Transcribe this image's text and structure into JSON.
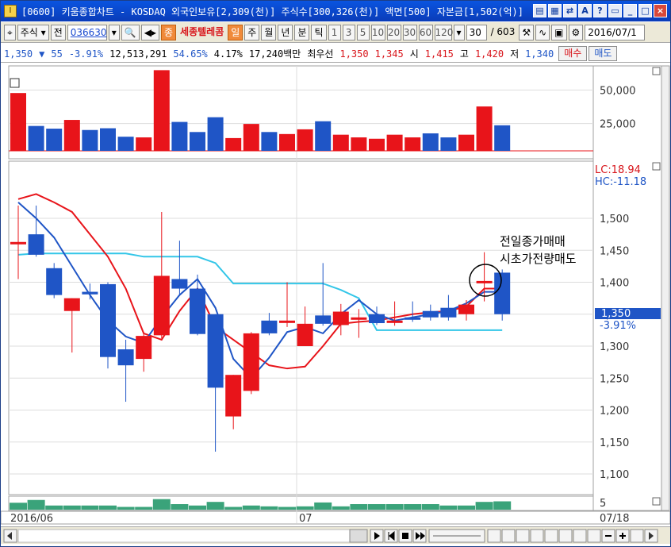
{
  "title": "[0600] 키움종합차트 - KOSDAQ 외국인보유[2,309(천)] 주식수[300,326(천)] 액면[500] 자본금[1,502(억)]",
  "toolbar": {
    "market": "주식",
    "field": "전",
    "code": "036630",
    "badge": "종",
    "stock_name": "세종텔레콤",
    "period_day": "일",
    "period_week": "주",
    "period_month": "월",
    "period_year": "년",
    "period_min": "분",
    "period_tick": "틱",
    "intervals": [
      "1",
      "3",
      "5",
      "10",
      "20",
      "30",
      "60",
      "120"
    ],
    "count": "30",
    "total": "/ 603",
    "date": "2016/07/1"
  },
  "pricebar": {
    "price": "1,350",
    "arrow": "▼",
    "change": "55",
    "change_pct": "-3.91%",
    "volume": "12,513,291",
    "ratio1": "54.65%",
    "ratio2": "4.17%",
    "amount": "17,240백만",
    "best_label": "최우선",
    "best_ask": "1,350",
    "best_bid": "1,345",
    "open_label": "시",
    "open": "1,415",
    "high_label": "고",
    "high": "1,420",
    "low_label": "저",
    "low": "1,340",
    "buy_label": "매수",
    "sell_label": "매도"
  },
  "chart_data": {
    "type": "candlestick",
    "x_start_label": "2016/06",
    "x_mid_label": "07",
    "x_end_label": "07/18",
    "price_axis": {
      "ticks": [
        "1,500",
        "1,450",
        "1,400",
        "1,350",
        "1,300",
        "1,250",
        "1,200",
        "1,150",
        "1,100"
      ],
      "range": [
        1060,
        1560
      ]
    },
    "volume_axis": {
      "ticks": [
        "50,000",
        "25,000"
      ],
      "range": [
        0,
        62000
      ]
    },
    "lc_label": "LC:18.94",
    "hc_label": "HC:-11.18",
    "current_price_label": "1,350",
    "current_change_label": "-3.91%",
    "annotation_line1": "전일종가매매",
    "annotation_line2": "시초가전량매도",
    "sub_axis_label": "5",
    "candles": [
      {
        "o": 1463,
        "c": 1463,
        "h": 1520,
        "l": 1405,
        "up": true
      },
      {
        "o": 1475,
        "c": 1443,
        "h": 1520,
        "l": 1440,
        "up": false
      },
      {
        "o": 1422,
        "c": 1380,
        "h": 1430,
        "l": 1375,
        "up": false
      },
      {
        "o": 1355,
        "c": 1375,
        "h": 1375,
        "l": 1290,
        "up": true
      },
      {
        "o": 1385,
        "c": 1381,
        "h": 1398,
        "l": 1373,
        "up": false
      },
      {
        "o": 1397,
        "c": 1283,
        "h": 1400,
        "l": 1265,
        "up": false
      },
      {
        "o": 1295,
        "c": 1270,
        "h": 1310,
        "l": 1213,
        "up": false
      },
      {
        "o": 1280,
        "c": 1316,
        "h": 1320,
        "l": 1260,
        "up": true
      },
      {
        "o": 1317,
        "c": 1410,
        "h": 1510,
        "l": 1312,
        "up": true
      },
      {
        "o": 1405,
        "c": 1390,
        "h": 1465,
        "l": 1380,
        "up": false
      },
      {
        "o": 1390,
        "c": 1319,
        "h": 1412,
        "l": 1317,
        "up": false
      },
      {
        "o": 1350,
        "c": 1235,
        "h": 1350,
        "l": 1135,
        "up": false
      },
      {
        "o": 1190,
        "c": 1255,
        "h": 1255,
        "l": 1170,
        "up": true
      },
      {
        "o": 1230,
        "c": 1320,
        "h": 1322,
        "l": 1225,
        "up": true
      },
      {
        "o": 1340,
        "c": 1320,
        "h": 1352,
        "l": 1317,
        "up": false
      },
      {
        "o": 1339,
        "c": 1340,
        "h": 1400,
        "l": 1330,
        "up": true
      },
      {
        "o": 1300,
        "c": 1335,
        "h": 1362,
        "l": 1300,
        "up": true
      },
      {
        "o": 1348,
        "c": 1335,
        "h": 1430,
        "l": 1332,
        "up": false
      },
      {
        "o": 1333,
        "c": 1354,
        "h": 1366,
        "l": 1317,
        "up": true
      },
      {
        "o": 1345,
        "c": 1345,
        "h": 1358,
        "l": 1313,
        "up": true
      },
      {
        "o": 1350,
        "c": 1336,
        "h": 1362,
        "l": 1333,
        "up": false
      },
      {
        "o": 1340,
        "c": 1340,
        "h": 1370,
        "l": 1332,
        "up": true
      },
      {
        "o": 1345,
        "c": 1345,
        "h": 1370,
        "l": 1338,
        "up": false
      },
      {
        "o": 1345,
        "c": 1355,
        "h": 1365,
        "l": 1340,
        "up": false
      },
      {
        "o": 1345,
        "c": 1360,
        "h": 1380,
        "l": 1340,
        "up": false
      },
      {
        "o": 1350,
        "c": 1365,
        "h": 1372,
        "l": 1340,
        "up": true
      },
      {
        "o": 1402,
        "c": 1402,
        "h": 1447,
        "l": 1370,
        "up": true
      },
      {
        "o": 1415,
        "c": 1350,
        "h": 1420,
        "l": 1340,
        "up": false
      }
    ],
    "volumes": [
      {
        "v": 43000,
        "up": true
      },
      {
        "v": 18500,
        "up": false
      },
      {
        "v": 16500,
        "up": false
      },
      {
        "v": 23000,
        "up": true
      },
      {
        "v": 15500,
        "up": false
      },
      {
        "v": 16800,
        "up": false
      },
      {
        "v": 10500,
        "up": false
      },
      {
        "v": 10000,
        "up": true
      },
      {
        "v": 60000,
        "up": true
      },
      {
        "v": 21500,
        "up": false
      },
      {
        "v": 14000,
        "up": false
      },
      {
        "v": 25000,
        "up": false
      },
      {
        "v": 9500,
        "up": true
      },
      {
        "v": 20000,
        "up": true
      },
      {
        "v": 14000,
        "up": false
      },
      {
        "v": 12500,
        "up": true
      },
      {
        "v": 16000,
        "up": true
      },
      {
        "v": 22000,
        "up": false
      },
      {
        "v": 12000,
        "up": true
      },
      {
        "v": 10000,
        "up": true
      },
      {
        "v": 9000,
        "up": true
      },
      {
        "v": 12000,
        "up": true
      },
      {
        "v": 10000,
        "up": true
      },
      {
        "v": 13000,
        "up": false
      },
      {
        "v": 10000,
        "up": false
      },
      {
        "v": 12000,
        "up": true
      },
      {
        "v": 33000,
        "up": true
      },
      {
        "v": 19000,
        "up": false
      }
    ],
    "line_red": [
      1530,
      1538,
      1525,
      1510,
      1475,
      1440,
      1390,
      1320,
      1310,
      1355,
      1390,
      1330,
      1310,
      1290,
      1270,
      1265,
      1268,
      1300,
      1335,
      1338,
      1340,
      1345,
      1350,
      1353,
      1355,
      1362,
      1390,
      1390
    ],
    "line_blue": [
      1525,
      1500,
      1470,
      1425,
      1380,
      1340,
      1315,
      1305,
      1345,
      1380,
      1405,
      1360,
      1280,
      1250,
      1282,
      1322,
      1330,
      1320,
      1350,
      1372,
      1350,
      1340,
      1345,
      1350,
      1355,
      1367,
      1385,
      1385
    ],
    "line_cyan": [
      1443,
      1445,
      1445,
      1445,
      1445,
      1445,
      1445,
      1440,
      1440,
      1440,
      1440,
      1430,
      1398,
      1398,
      1398,
      1398,
      1398,
      1398,
      1388,
      1375,
      1325,
      1325,
      1325,
      1325,
      1325,
      1325,
      1325,
      1325
    ],
    "sub_values": [
      2.5,
      3.5,
      1.5,
      1.5,
      1.5,
      1.5,
      1.0,
      1.0,
      3.8,
      2.0,
      1.5,
      2.8,
      1.0,
      1.5,
      1.2,
      1.0,
      1.2,
      2.6,
      1.2,
      2.0,
      2.0,
      2.0,
      2.0,
      2.0,
      1.5,
      1.5,
      2.8,
      3.0
    ]
  }
}
